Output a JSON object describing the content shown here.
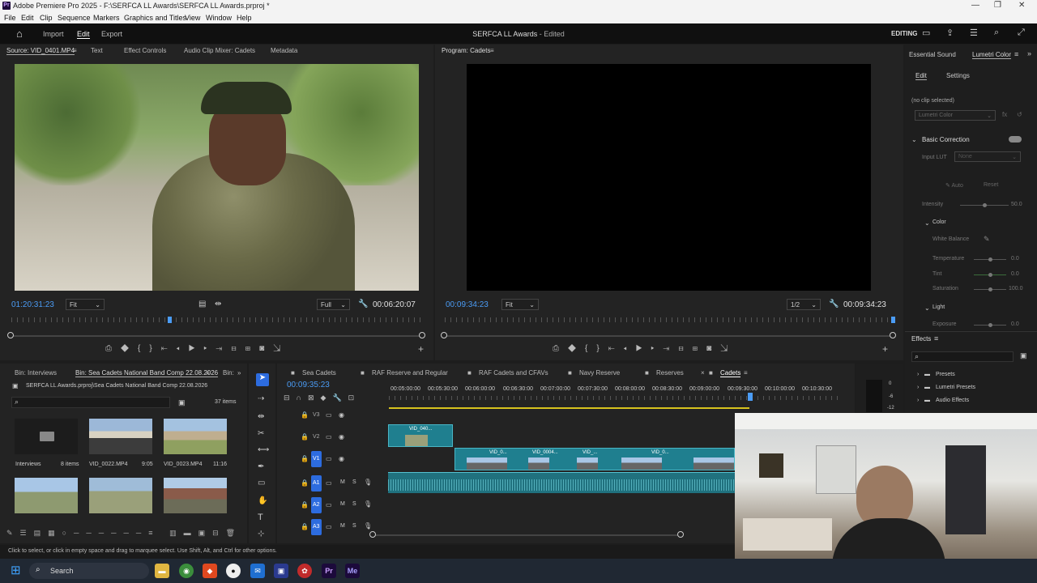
{
  "window": {
    "title": "Adobe Premiere Pro 2025 - F:\\SERFCA LL Awards\\SERFCA LL Awards.prproj *"
  },
  "menu": [
    "File",
    "Edit",
    "Clip",
    "Sequence",
    "Markers",
    "Graphics and Titles",
    "View",
    "Window",
    "Help"
  ],
  "appbar": {
    "nav": [
      "Import",
      "Edit",
      "Export"
    ],
    "project": "SERFCA LL Awards",
    "status": "- Edited",
    "workspace": "EDITING"
  },
  "source": {
    "tabs": [
      "Source: VID_0401.MP4",
      "Text",
      "Effect Controls",
      "Audio Clip Mixer: Cadets",
      "Metadata"
    ],
    "timecode": "01:20:31:23",
    "fit": "Fit",
    "quality": "Full",
    "duration": "00:06:20:07"
  },
  "program": {
    "tab": "Program: Cadets",
    "timecode": "00:09:34:23",
    "fit": "Fit",
    "quality": "1/2",
    "duration": "00:09:34:23"
  },
  "lumetri": {
    "tabs": [
      "Essential Sound",
      "Lumetri Color"
    ],
    "subtabs": [
      "Edit",
      "Settings"
    ],
    "clip": "(no clip selected)",
    "dropdown": "Lumetri Color",
    "basic": "Basic Correction",
    "input_lut": "Input LUT",
    "lut_value": "None",
    "auto": "Auto",
    "reset": "Reset",
    "intensity": {
      "label": "Intensity",
      "value": "50.0"
    },
    "color": "Color",
    "white_balance": "White Balance",
    "temperature": {
      "label": "Temperature",
      "value": "0.0"
    },
    "tint": {
      "label": "Tint",
      "value": "0.0"
    },
    "saturation": {
      "label": "Saturation",
      "value": "100.0"
    },
    "light": "Light",
    "exposure": {
      "label": "Exposure",
      "value": "0.0"
    }
  },
  "effects": {
    "title": "Effects",
    "items": [
      "Presets",
      "Lumetri Presets",
      "Audio Effects"
    ]
  },
  "project": {
    "tabs": [
      "Bin: Interviews",
      "Bin: Sea Cadets National Band Comp 22.08.2026",
      "Bin:"
    ],
    "path": "SERFCA LL Awards.prproj\\Sea Cadets National Band Comp 22.08.2026",
    "count": "37 items",
    "items": [
      {
        "name": "Interviews",
        "meta": "8 items"
      },
      {
        "name": "VID_0022.MP4",
        "meta": "9:05"
      },
      {
        "name": "VID_0023.MP4",
        "meta": "11:16"
      }
    ]
  },
  "timeline": {
    "tabs": [
      "Sea Cadets",
      "RAF Reserve and Regular",
      "RAF Cadets and CFAVs",
      "Navy Reserve",
      "Reserves",
      "Cadets"
    ],
    "timecode": "00:09:35:23",
    "ruler": [
      "00:05:00:00",
      "00:05:30:00",
      "00:06:00:00",
      "00:06:30:00",
      "00:07:00:00",
      "00:07:30:00",
      "00:08:00:00",
      "00:08:30:00",
      "00:09:00:00",
      "00:09:30:00",
      "00:10:00:00",
      "00:10:30:00"
    ],
    "video_tracks": [
      "V3",
      "V2",
      "V1"
    ],
    "audio_tracks": [
      "A1",
      "A2",
      "A3"
    ],
    "clips_v2": [
      "VID_040..."
    ],
    "clips_v1": [
      "VID_0...",
      "VID_0004...",
      "VID_...",
      "VID_0..."
    ],
    "meter": [
      "0",
      "-6",
      "-12"
    ]
  },
  "status": "Click to select, or click in empty space and drag to marquee select. Use Shift, Alt, and Ctrl for other options.",
  "taskbar": {
    "search": "Search"
  }
}
